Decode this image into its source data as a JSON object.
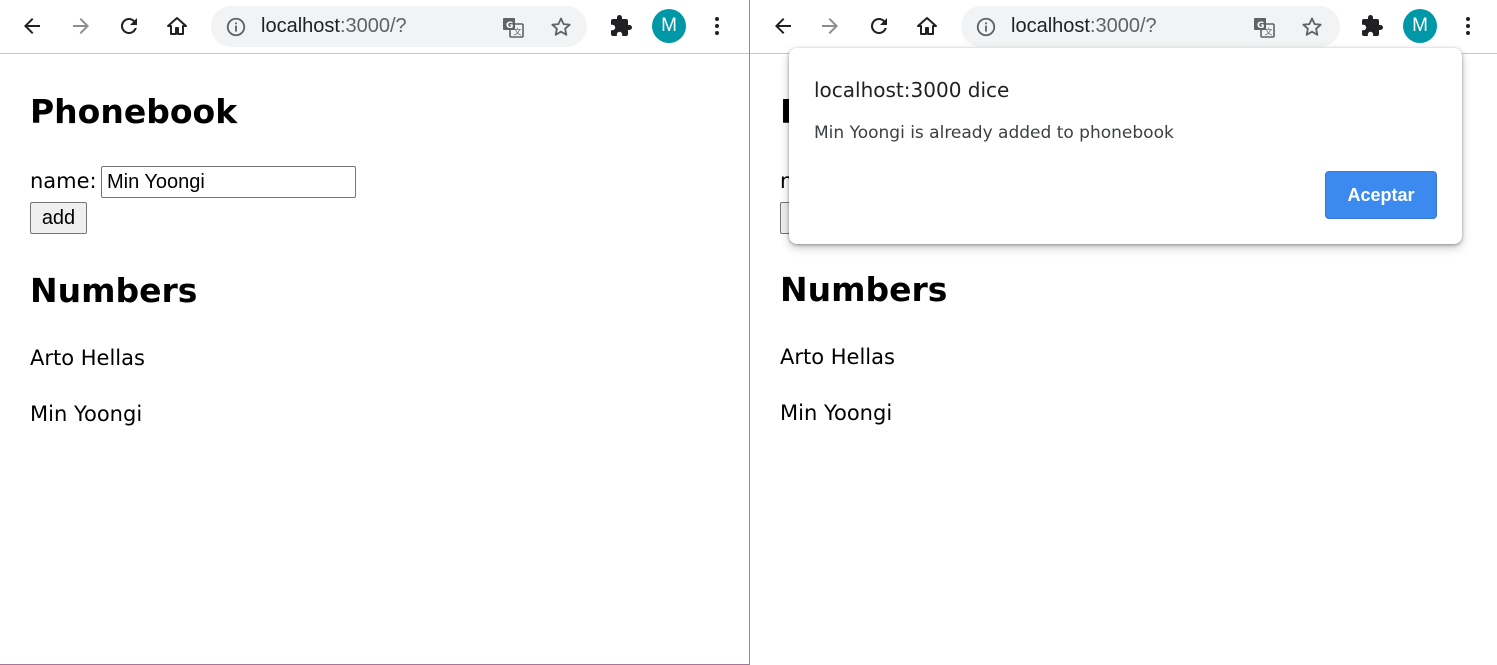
{
  "colors": {
    "accent": "#3c89f0",
    "avatar_bg": "#0097a7",
    "omnibox_bg": "#f1f3f4"
  },
  "browser": {
    "url_host": "localhost",
    "url_path": ":3000/?",
    "avatar_initial": "M",
    "icons": [
      "back-icon",
      "forward-icon",
      "reload-icon",
      "home-icon",
      "info-icon",
      "translate-icon",
      "star-icon",
      "extensions-icon",
      "more-icon"
    ]
  },
  "app": {
    "heading": "Phonebook",
    "name_label": "name:",
    "name_value": "Min Yoongi",
    "add_label": "add",
    "numbers_heading": "Numbers",
    "entries": [
      "Arto Hellas",
      "Min Yoongi"
    ]
  },
  "dialog": {
    "title": "localhost:3000 dice",
    "message": "Min Yoongi is already added to phonebook",
    "ok_label": "Aceptar"
  }
}
